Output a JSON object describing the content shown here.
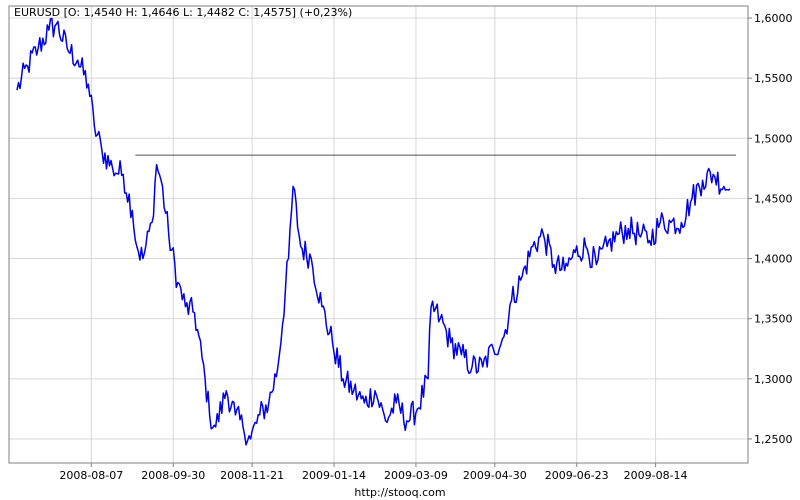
{
  "chart_data": {
    "type": "line",
    "instrument": "EURUSD",
    "title": "EURUSD [O: 1,4540  H: 1,4646  L: 1,4482  C: 1,4575] (+0,23%)",
    "footer": "http://stooq.com",
    "colors": {
      "series": "#0000e0",
      "grid": "#d8d8d8",
      "frame": "#808080",
      "resistance": "#505050"
    },
    "grid": true,
    "ylim": [
      1.23,
      1.61
    ],
    "y_ticks": [
      {
        "value": 1.6,
        "label": "1,6000"
      },
      {
        "value": 1.55,
        "label": "1,5500"
      },
      {
        "value": 1.5,
        "label": "1,5000"
      },
      {
        "value": 1.45,
        "label": "1,4500"
      },
      {
        "value": 1.4,
        "label": "1,4000"
      },
      {
        "value": 1.35,
        "label": "1,3500"
      },
      {
        "value": 1.3,
        "label": "1,3000"
      },
      {
        "value": 1.25,
        "label": "1,2500"
      }
    ],
    "x_range": [
      "2008-06-19",
      "2009-10-06"
    ],
    "x_ticks": [
      "2008-08-07",
      "2008-09-30",
      "2008-11-21",
      "2009-01-14",
      "2009-03-09",
      "2009-04-30",
      "2009-06-23",
      "2009-08-14"
    ],
    "resistance_line": {
      "value": 1.486,
      "from": "2008-09-05",
      "to": "2009-10-06"
    },
    "series": [
      {
        "x": [
          "2008-06-19",
          "2008-06-26",
          "2008-07-03",
          "2008-07-10",
          "2008-07-15",
          "2008-07-22",
          "2008-07-29",
          "2008-08-05",
          "2008-08-09",
          "2008-08-14",
          "2008-08-21",
          "2008-08-28",
          "2008-09-03",
          "2008-09-06",
          "2008-09-10",
          "2008-09-16",
          "2008-09-19",
          "2008-09-22",
          "2008-09-27",
          "2008-10-03",
          "2008-10-08",
          "2008-10-14",
          "2008-10-21",
          "2008-10-24",
          "2008-10-28",
          "2008-11-04",
          "2008-11-10",
          "2008-11-15",
          "2008-11-20",
          "2008-11-26",
          "2008-12-02",
          "2008-12-08",
          "2008-12-15",
          "2008-12-18",
          "2008-12-23",
          "2008-12-30",
          "2009-01-06",
          "2009-01-13",
          "2009-01-20",
          "2009-01-27",
          "2009-02-03",
          "2009-02-10",
          "2009-02-17",
          "2009-02-24",
          "2009-03-03",
          "2009-03-10",
          "2009-03-17",
          "2009-03-19",
          "2009-03-25",
          "2009-04-01",
          "2009-04-08",
          "2009-04-15",
          "2009-04-22",
          "2009-04-29",
          "2009-05-06",
          "2009-05-11",
          "2009-05-18",
          "2009-05-25",
          "2009-06-01",
          "2009-06-08",
          "2009-06-15",
          "2009-06-22",
          "2009-06-29",
          "2009-07-06",
          "2009-07-13",
          "2009-07-20",
          "2009-07-27",
          "2009-08-03",
          "2009-08-10",
          "2009-08-17",
          "2009-08-24",
          "2009-08-31",
          "2009-09-07",
          "2009-09-14",
          "2009-09-21",
          "2009-09-28",
          "2009-10-02"
        ],
        "y": [
          1.54,
          1.56,
          1.575,
          1.59,
          1.595,
          1.575,
          1.565,
          1.545,
          1.51,
          1.49,
          1.475,
          1.47,
          1.44,
          1.41,
          1.4,
          1.43,
          1.478,
          1.465,
          1.42,
          1.38,
          1.36,
          1.355,
          1.3,
          1.27,
          1.26,
          1.29,
          1.27,
          1.26,
          1.25,
          1.27,
          1.28,
          1.31,
          1.4,
          1.46,
          1.41,
          1.4,
          1.36,
          1.33,
          1.3,
          1.29,
          1.28,
          1.29,
          1.265,
          1.28,
          1.265,
          1.275,
          1.3,
          1.36,
          1.35,
          1.33,
          1.32,
          1.31,
          1.31,
          1.325,
          1.335,
          1.365,
          1.385,
          1.41,
          1.42,
          1.395,
          1.39,
          1.405,
          1.41,
          1.395,
          1.41,
          1.42,
          1.425,
          1.42,
          1.415,
          1.43,
          1.43,
          1.43,
          1.45,
          1.465,
          1.47,
          1.46,
          1.458
        ]
      }
    ]
  }
}
